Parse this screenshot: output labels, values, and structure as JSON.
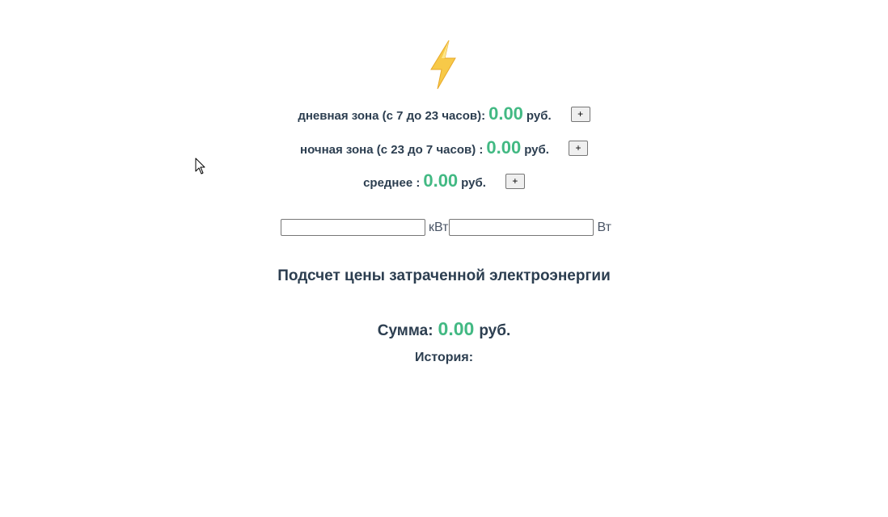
{
  "icons": {
    "logo": "lightning-bolt-icon",
    "cursor": "mouse-pointer-icon"
  },
  "colors": {
    "accent": "#42b983",
    "text": "#2c3e50",
    "bolt": "#f7c948"
  },
  "rates": {
    "day": {
      "label": "дневная зона (с 7 до 23 часов):",
      "value": "0.00",
      "currency": "руб.",
      "button": "+"
    },
    "night": {
      "label": "ночная зона (с 23 до 7 часов) :",
      "value": "0.00",
      "currency": "руб.",
      "button": "+"
    },
    "average": {
      "label": "среднее :",
      "value": "0.00",
      "currency": "руб.",
      "button": "+"
    }
  },
  "inputs": {
    "kw": {
      "value": "",
      "unit": "кВт"
    },
    "w": {
      "value": "",
      "unit": "Вт"
    }
  },
  "heading": "Подсчет цены затраченной электроэнергии",
  "sum": {
    "label": "Сумма:",
    "value": "0.00",
    "currency": "руб."
  },
  "history": {
    "label": "История:"
  }
}
